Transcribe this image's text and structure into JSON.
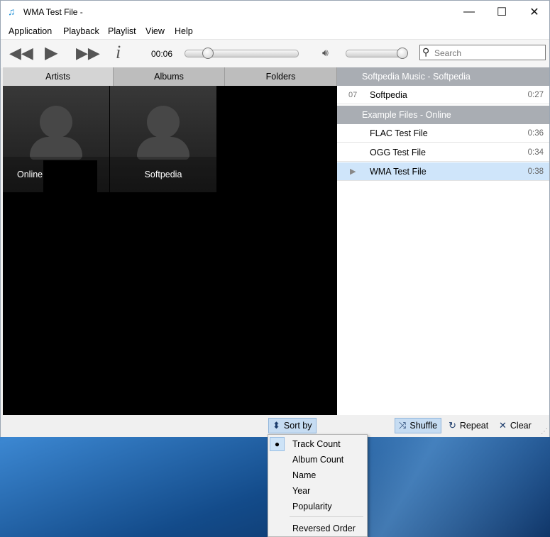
{
  "window": {
    "title": "WMA Test File -",
    "controls": {
      "minimize": "—",
      "maximize": "☐",
      "close": "✕"
    }
  },
  "menu": [
    "Application",
    "Playback",
    "Playlist",
    "View",
    "Help"
  ],
  "toolbar": {
    "time": "00:06",
    "progress_fraction": 0.21,
    "volume_fraction": 0.98,
    "search_placeholder": "Search"
  },
  "library": {
    "tabs": [
      "Artists",
      "Albums",
      "Folders"
    ],
    "active_tab": "Artists",
    "artists": [
      "Online",
      "Softpedia"
    ]
  },
  "playlist": {
    "groups": [
      {
        "header": "Softpedia Music - Softpedia",
        "tracks": [
          {
            "num": "07",
            "title": "Softpedia",
            "duration": "0:27"
          }
        ]
      },
      {
        "header": "Example Files - Online",
        "tracks": [
          {
            "num": "",
            "title": "FLAC Test File",
            "duration": "0:36"
          },
          {
            "num": "",
            "title": "OGG Test File",
            "duration": "0:34"
          },
          {
            "num": "",
            "title": "WMA Test File",
            "duration": "0:38",
            "playing": true
          }
        ]
      }
    ]
  },
  "bottom": {
    "sort_by": "Sort by",
    "shuffle": "Shuffle",
    "repeat": "Repeat",
    "clear": "Clear"
  },
  "sort_menu": {
    "items": [
      "Track Count",
      "Album Count",
      "Name",
      "Year",
      "Popularity"
    ],
    "selected": "Track Count",
    "reversed": "Reversed Order"
  },
  "colors": {
    "accent": "#1e8fd6",
    "playlist_header": "#a9adb3",
    "active_row": "#cfe5fa"
  }
}
